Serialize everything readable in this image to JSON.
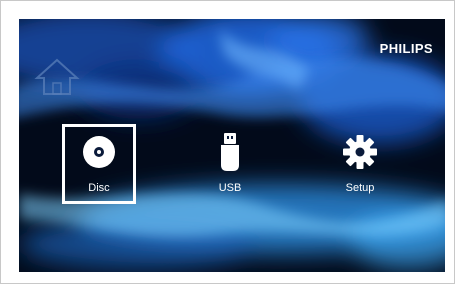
{
  "brand": "PHILIPS",
  "home_icon": "home-icon",
  "menu": {
    "items": [
      {
        "label": "Disc",
        "icon": "disc-icon",
        "selected": true
      },
      {
        "label": "USB",
        "icon": "usb-drive-icon",
        "selected": false
      },
      {
        "label": "Setup",
        "icon": "gear-icon",
        "selected": false
      }
    ]
  },
  "colors": {
    "background": "#020a1a",
    "accent_blue": "#1e8fe0",
    "text": "#ffffff"
  }
}
